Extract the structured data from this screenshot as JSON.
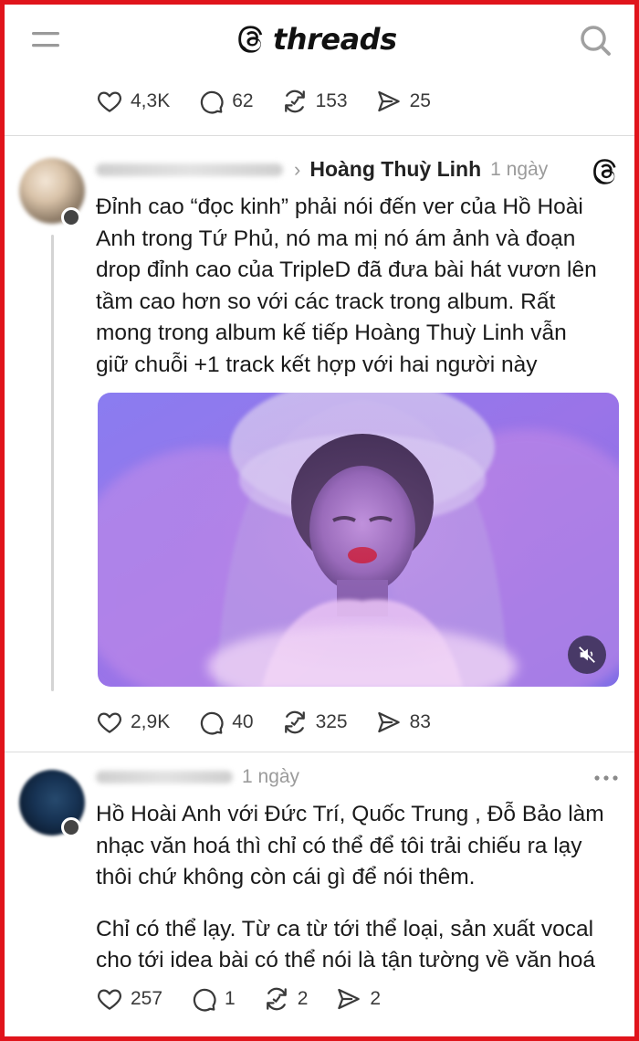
{
  "app": {
    "logo_text": "threads"
  },
  "top_post_stats": {
    "likes": "4,3K",
    "replies": "62",
    "reposts": "153",
    "shares": "25"
  },
  "post1": {
    "reply_to": "Hoàng Thuỳ Linh",
    "time": "1 ngày",
    "text_lines": [
      "Đỉnh cao “đọc kinh” phải nói đến ver của Hồ Hoài",
      "Anh trong Tứ Phủ, nó ma mị nó ám ảnh và đoạn",
      "drop đỉnh cao của TripleD đã đưa bài hát vươn lên",
      "tầm cao hơn so với các track trong album. Rất",
      "mong trong album kế tiếp Hoàng Thuỳ Linh vẫn",
      "giữ chuỗi +1 track kết hợp với hai người này"
    ],
    "stats": {
      "likes": "2,9K",
      "replies": "40",
      "reposts": "325",
      "shares": "83"
    }
  },
  "post2": {
    "time": "1 ngày",
    "paragraph1_lines": [
      "Hồ Hoài Anh với Đức Trí, Quốc Trung , Đỗ Bảo làm",
      "nhạc văn hoá thì chỉ có thể để tôi trải chiếu ra lạy",
      "thôi chứ không còn cái gì để nói thêm."
    ],
    "paragraph2_lines": [
      "Chỉ có thể lạy. Từ ca từ tới thể loại, sản xuất vocal",
      "cho tới idea bài có thể nói là tận tường về văn hoá"
    ],
    "stats": {
      "likes": "257",
      "replies": "1",
      "reposts": "2",
      "shares": "2"
    }
  },
  "colors": {
    "frame_border": "#e0141b",
    "secondary_text": "#9b9b9b",
    "icon": "#3a3a3a"
  },
  "icons": [
    "menu-icon",
    "threads-logo-icon",
    "search-icon",
    "heart-icon",
    "comment-icon",
    "repost-icon",
    "share-icon",
    "mute-icon",
    "more-icon"
  ]
}
